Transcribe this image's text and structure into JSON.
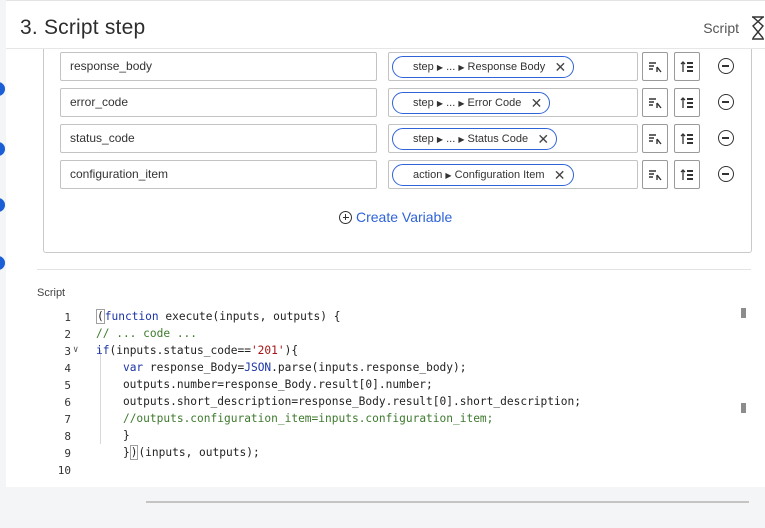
{
  "header": {
    "title": "3. Script step",
    "right_label": "Script",
    "right_icon": "hourglass-icon"
  },
  "variables": [
    {
      "name": "response_body",
      "pill": {
        "root": "step",
        "ellipsis": "...",
        "leaf": "Response Body"
      }
    },
    {
      "name": "error_code",
      "pill": {
        "root": "step",
        "ellipsis": "...",
        "leaf": "Error Code"
      }
    },
    {
      "name": "status_code",
      "pill": {
        "root": "step",
        "ellipsis": "...",
        "leaf": "Status Code"
      }
    },
    {
      "name": "configuration_item",
      "pill": {
        "root": "action",
        "leaf": "Configuration Item"
      }
    }
  ],
  "create_variable_label": "Create Variable",
  "script": {
    "label": "Script",
    "line_numbers": [
      "1",
      "2",
      "3",
      "4",
      "5",
      "6",
      "7",
      "8",
      "9",
      "10"
    ]
  },
  "colors": {
    "accent": "#2f63d8",
    "keyword": "#1c35a8",
    "comment": "#3e7a2e",
    "string": "#a31515"
  }
}
